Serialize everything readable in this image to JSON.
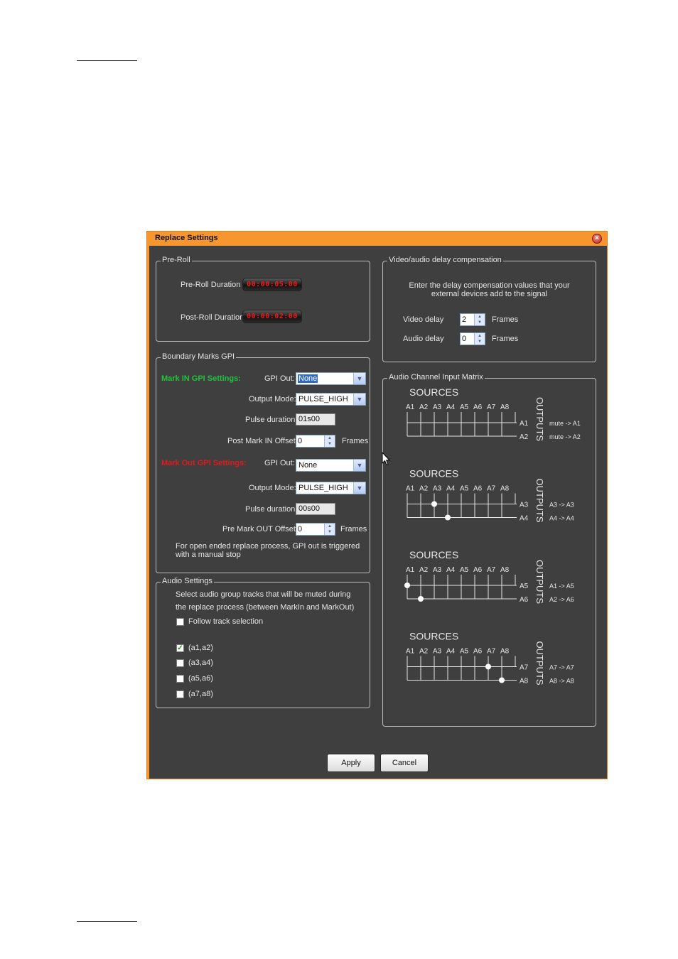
{
  "window": {
    "title": "Replace Settings",
    "close_icon": "close-icon",
    "accent_color": "#f7962e"
  },
  "preroll": {
    "title": "Pre-Roll",
    "preroll_label": "Pre-Roll Duration",
    "preroll_value": "00:00:05:00",
    "postroll_label": "Post-Roll Duration",
    "postroll_value": "00:00:02:00"
  },
  "gpi": {
    "title": "Boundary Marks GPI",
    "mark_in_heading": "Mark IN GPI Settings:",
    "mark_in_color": "#22c33a",
    "mark_out_heading": "Mark Out GPI Settings:",
    "mark_out_color": "#e01a1a",
    "gpi_out_label": "GPI Out:",
    "output_mode_label": "Output Mode:",
    "pulse_duration_label": "Pulse duration:",
    "in_gpi_out": "None",
    "in_output_mode": "PULSE_HIGH",
    "in_pulse_duration": "01s00",
    "post_mark_in_label": "Post Mark IN Offset:",
    "post_mark_in_value": "0",
    "frames_label": "Frames",
    "out_gpi_out": "None",
    "out_output_mode": "PULSE_HIGH",
    "out_pulse_duration": "00s00",
    "pre_mark_out_label": "Pre Mark OUT Offset:",
    "pre_mark_out_value": "0",
    "note_line1": "For open ended replace process, GPI out is triggered",
    "note_line2": "with a manual stop"
  },
  "audio": {
    "title": "Audio Settings",
    "desc_line1": "Select audio group tracks that will be muted during",
    "desc_line2": "the replace process (between MarkIn and MarkOut)",
    "follow_label": "Follow track selection",
    "follow_checked": false,
    "groups": [
      {
        "label": "(a1,a2)",
        "checked": true
      },
      {
        "label": "(a3,a4)",
        "checked": false
      },
      {
        "label": "(a5,a6)",
        "checked": false
      },
      {
        "label": "(a7,a8)",
        "checked": false
      }
    ]
  },
  "delay": {
    "title": "Video/audio delay compensation",
    "desc_line1": "Enter the delay compensation values that your",
    "desc_line2": "external devices add to the signal",
    "video_label": "Video delay",
    "video_value": "2",
    "audio_label": "Audio delay",
    "audio_value": "0",
    "frames_label": "Frames"
  },
  "matrix": {
    "title": "Audio Channel Input Matrix",
    "sources_label": "SOURCES",
    "outputs_label": "OUTPUTS",
    "source_channels": [
      "A1",
      "A2",
      "A3",
      "A4",
      "A5",
      "A6",
      "A7",
      "A8"
    ],
    "blocks": [
      {
        "outputs": [
          "A1",
          "A2"
        ],
        "routes": [
          "mute -> A1",
          "mute -> A2"
        ],
        "dots": [
          null,
          null
        ]
      },
      {
        "outputs": [
          "A3",
          "A4"
        ],
        "routes": [
          "A3   -> A3",
          "A4   -> A4"
        ],
        "dots": [
          3,
          4
        ]
      },
      {
        "outputs": [
          "A5",
          "A6"
        ],
        "routes": [
          "A1   -> A5",
          "A2   -> A6"
        ],
        "dots": [
          1,
          2
        ]
      },
      {
        "outputs": [
          "A7",
          "A8"
        ],
        "routes": [
          "A7   -> A7",
          "A8   -> A8"
        ],
        "dots": [
          7,
          8
        ]
      }
    ]
  },
  "footer": {
    "apply_label": "Apply",
    "cancel_label": "Cancel"
  }
}
